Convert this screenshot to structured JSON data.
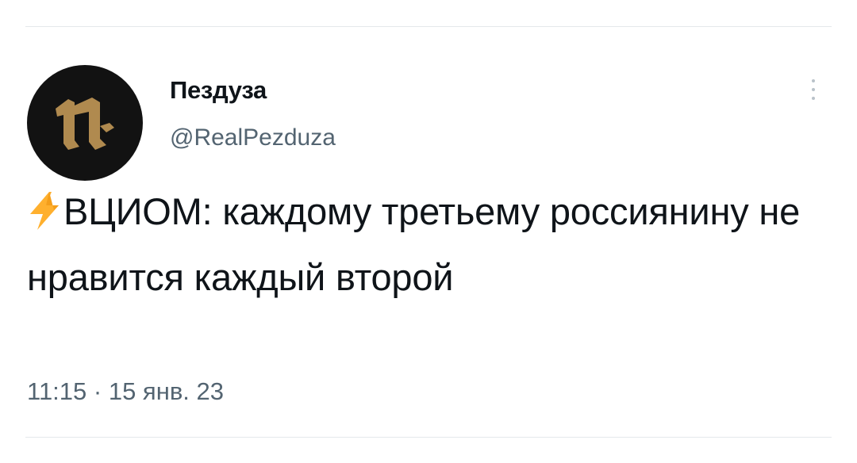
{
  "tweet": {
    "author": {
      "display_name": "Пездуза",
      "handle": "@RealPezduza",
      "avatar_icon": "pezduza-logo-icon",
      "avatar_bg": "#121212",
      "avatar_fg": "#b08a4f"
    },
    "text_icon": "lightning-emoji-icon",
    "text": "ВЦИОМ: каждому третьему россиянину не нравится каждый второй",
    "timestamp": "11:15 · 15 янв. 23",
    "more_icon": "more-vertical-icon"
  },
  "colors": {
    "text_primary": "#0f1419",
    "text_secondary": "#536471",
    "divider": "#e4e8eb",
    "bolt": "#ffb02e"
  }
}
